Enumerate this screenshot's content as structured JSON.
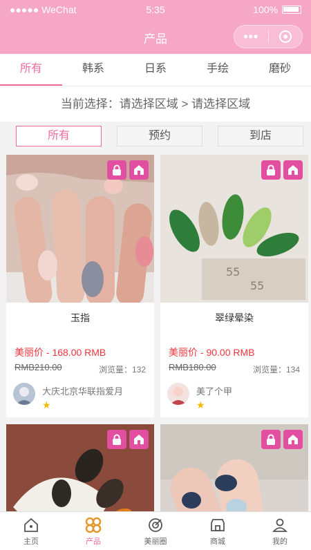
{
  "statusbar": {
    "carrier": "●●●●● WeChat",
    "time": "5:35",
    "battery": "100%"
  },
  "navbar": {
    "title": "产品",
    "more": "•••"
  },
  "tabs": [
    "所有",
    "韩系",
    "日系",
    "手绘",
    "磨砂"
  ],
  "selection": "当前选择：请选择区域 > 请选择区域",
  "filters": [
    "所有",
    "预约",
    "到店"
  ],
  "products": [
    {
      "name": "玉指",
      "price": "美丽价 - 168.00 RMB",
      "original": "RMB210.00",
      "views": "浏览量：132",
      "author": "大庆北京华联指爱月"
    },
    {
      "name": "翠绿晕染",
      "price": "美丽价 - 90.00 RMB",
      "original": "RMB180.00",
      "views": "浏览量：134",
      "author": "美了个甲"
    }
  ],
  "bottomnav": [
    "主页",
    "产品",
    "美丽圈",
    "商城",
    "我的"
  ],
  "colors": {
    "primary": "#f7a7c6",
    "accent": "#f06a9e",
    "price": "#f0343c"
  }
}
